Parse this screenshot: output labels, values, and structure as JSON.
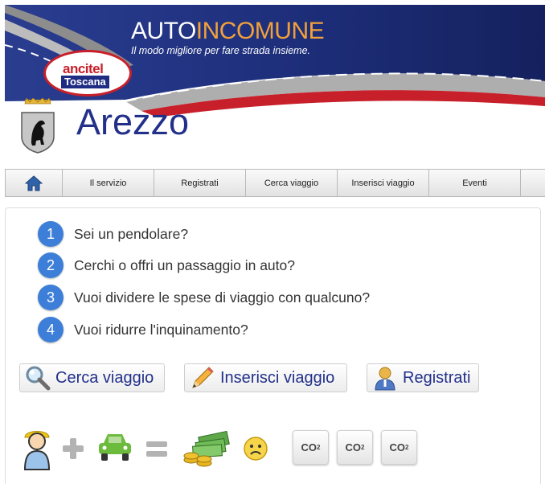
{
  "header": {
    "brand_prefix": "AUTO",
    "brand_suffix": "INCOMUNE",
    "tagline": "Il modo migliore per fare strada insieme.",
    "logo_top": "ancitel",
    "logo_bottom": "Toscana"
  },
  "city": {
    "name": "Arezzo"
  },
  "nav": {
    "items": [
      {
        "label": "Il servizio"
      },
      {
        "label": "Registrati"
      },
      {
        "label": "Cerca viaggio"
      },
      {
        "label": "Inserisci viaggio"
      },
      {
        "label": "Eventi"
      }
    ]
  },
  "questions": [
    {
      "num": "1",
      "text": "Sei un pendolare?"
    },
    {
      "num": "2",
      "text": "Cerchi o offri un passaggio in auto?"
    },
    {
      "num": "3",
      "text": "Vuoi dividere le spese di viaggio con qualcuno?"
    },
    {
      "num": "4",
      "text": "Vuoi ridurre l'inquinamento?"
    }
  ],
  "actions": {
    "search": "Cerca viaggio",
    "insert": "Inserisci viaggio",
    "register": "Registrati"
  },
  "equation": {
    "co2_main": "CO",
    "co2_sub": "2",
    "icons": [
      "person-icon",
      "plus-icon",
      "car-icon",
      "equals-icon",
      "money-icon",
      "sad-face-icon",
      "co2-icon"
    ]
  },
  "colors": {
    "brand_blue": "#22308a",
    "accent_orange": "#f2a13a",
    "step_blue": "#3d7fd8",
    "car_green": "#6dbb3c",
    "ancitel_red": "#c8202a"
  }
}
